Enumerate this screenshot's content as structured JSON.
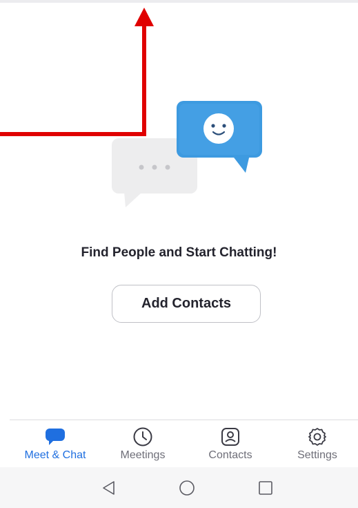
{
  "empty_state": {
    "headline": "Find People and Start Chatting!",
    "add_contacts_label": "Add Contacts"
  },
  "tabs": [
    {
      "label": "Meet & Chat",
      "icon": "chat-bubble-icon",
      "active": true
    },
    {
      "label": "Meetings",
      "icon": "clock-icon",
      "active": false
    },
    {
      "label": "Contacts",
      "icon": "contact-card-icon",
      "active": false
    },
    {
      "label": "Settings",
      "icon": "gear-icon",
      "active": false
    }
  ],
  "system_nav": {
    "back_icon": "triangle-back-icon",
    "home_icon": "circle-home-icon",
    "recents_icon": "square-recents-icon"
  },
  "colors": {
    "accent": "#1f6fe0",
    "annotation_arrow": "#e00000",
    "chat_bubble_blue": "#3d9ae0"
  }
}
